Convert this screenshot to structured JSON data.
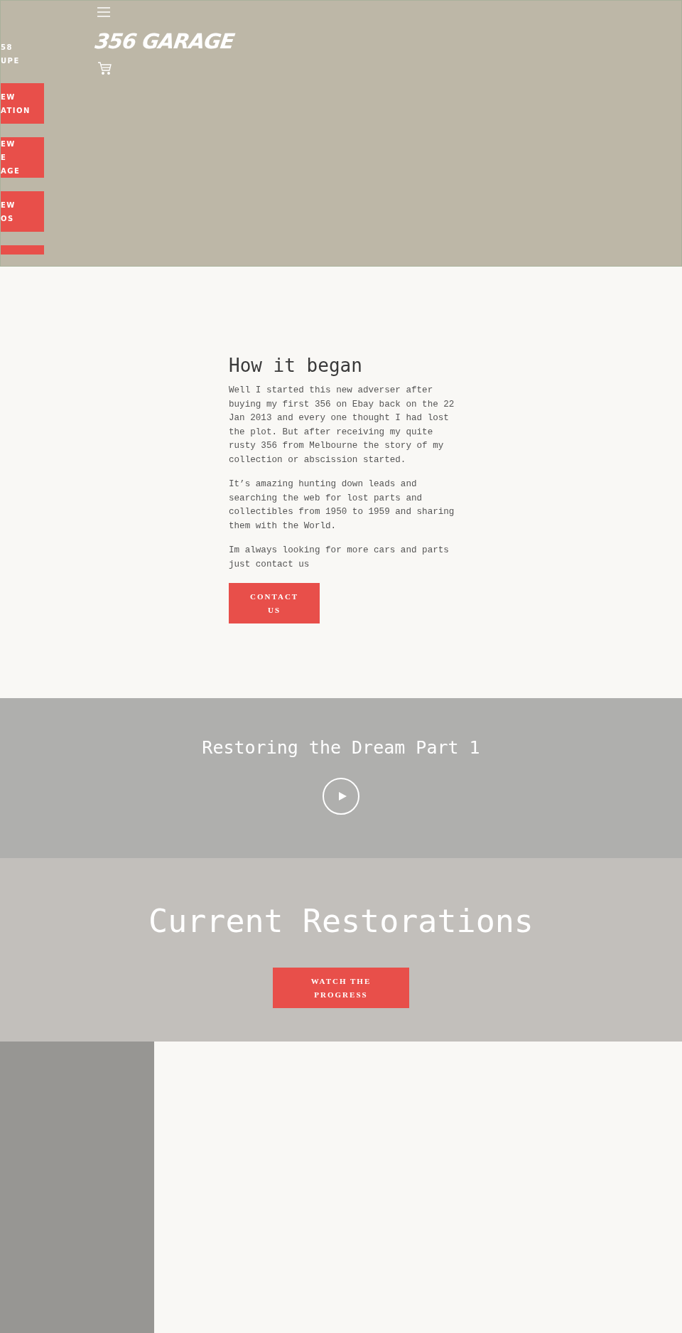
{
  "header": {
    "brand": "356 GARAGE"
  },
  "slideshow": {
    "caption": [
      "58",
      "UPE"
    ],
    "buttons": [
      {
        "kind": "labeled",
        "lines": [
          "EW",
          "ATION"
        ]
      },
      {
        "kind": "labeled",
        "lines": [
          "EW",
          "E",
          "AGE"
        ]
      },
      {
        "kind": "labeled",
        "lines": [
          "EW",
          "OS"
        ]
      },
      {
        "kind": "cut"
      }
    ]
  },
  "story": {
    "title": "How it began",
    "paragraphs": [
      "Well I started this new adverser after buying my first 356 on Ebay back on the 22 Jan 2013 and every one thought I had lost the plot. But after receiving my quite rusty 356 from Melbourne the story of my collection or abscission started.",
      "It’s amazing hunting down leads and searching the web for lost parts and collectibles from 1950 to 1959 and sharing them with the World.",
      "Im always looking for more cars and parts just contact us"
    ],
    "button": "CONTACT US"
  },
  "video": {
    "title": "Restoring the Dream Part 1"
  },
  "restorations": {
    "title": "Current Restorations",
    "button": "WATCH THE PROGRESS"
  }
}
